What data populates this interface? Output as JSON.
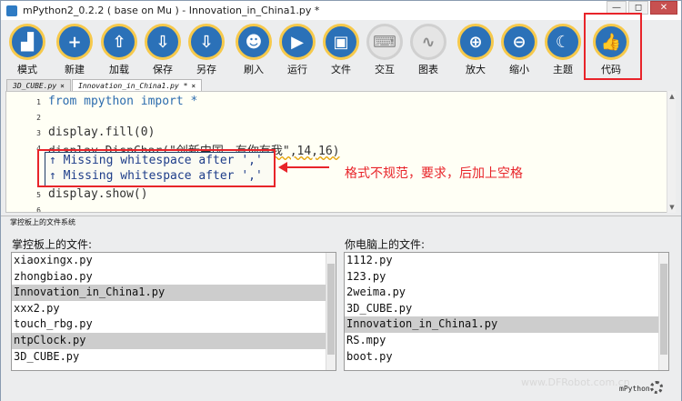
{
  "window": {
    "title": "mPython2_0.2.2 ( base on Mu ) - Innovation_in_China1.py *",
    "buttons": [
      "—",
      "◻",
      "✕"
    ]
  },
  "toolbar": {
    "buttons": [
      {
        "label": "模式",
        "icon": "mode-icon",
        "glyph": "▟"
      },
      {
        "label": "新建",
        "icon": "plus-icon",
        "glyph": "+"
      },
      {
        "label": "加载",
        "icon": "upload-icon",
        "glyph": "⇧"
      },
      {
        "label": "保存",
        "icon": "download-icon",
        "glyph": "⇩"
      },
      {
        "label": "另存",
        "icon": "save-as-icon",
        "glyph": "⇩"
      },
      {
        "label": "刷入",
        "icon": "robot-icon",
        "glyph": "☻"
      },
      {
        "label": "运行",
        "icon": "play-icon",
        "glyph": "▶"
      },
      {
        "label": "文件",
        "icon": "files-icon",
        "glyph": "▣"
      },
      {
        "label": "交互",
        "icon": "keyboard-icon",
        "glyph": "⌨"
      },
      {
        "label": "图表",
        "icon": "pulse-icon",
        "glyph": "∿"
      },
      {
        "label": "放大",
        "icon": "zoom-in-icon",
        "glyph": "⊕"
      },
      {
        "label": "缩小",
        "icon": "zoom-out-icon",
        "glyph": "⊖"
      },
      {
        "label": "主题",
        "icon": "moon-icon",
        "glyph": "☾"
      },
      {
        "label": "代码",
        "icon": "thumbs-up-icon",
        "glyph": "👍"
      }
    ]
  },
  "tabs": [
    {
      "label": "3D_CUBE.py",
      "close": "×"
    },
    {
      "label": "Innovation_in_China1.py *",
      "close": "×"
    }
  ],
  "editor": {
    "lines": [
      {
        "num": "1",
        "code": "from mpython import *"
      },
      {
        "num": "2",
        "code": ""
      },
      {
        "num": "3",
        "code": "display.fill(0)"
      },
      {
        "num": "4",
        "code": "display.DispChar(\"创新中国，有你有我\",14,16)"
      },
      {
        "num": "5",
        "code": "display.show()"
      },
      {
        "num": "6",
        "code": ""
      }
    ],
    "lint_messages": [
      "↑ Missing whitespace after ','",
      "↑ Missing whitespace after ','"
    ]
  },
  "annotation": "格式不规范，要求，后加上空格",
  "file_pane": {
    "title": "掌控板上的文件系统",
    "left_label": "掌控板上的文件:",
    "right_label": "你电脑上的文件:",
    "left_files": [
      "xiaoxingx.py",
      "zhongbiao.py",
      "Innovation_in_China1.py",
      "xxx2.py",
      "touch_rbg.py",
      "ntpClock.py",
      "3D_CUBE.py"
    ],
    "left_selected": [
      2,
      5
    ],
    "right_files": [
      "1112.py",
      "123.py",
      "2weima.py",
      "3D_CUBE.py",
      "Innovation_in_China1.py",
      "RS.mpy",
      "boot.py"
    ],
    "right_selected": [
      4
    ]
  },
  "status": {
    "watermark": "www.DFRobot.com.cn",
    "mode": "mPython"
  },
  "colors": {
    "button_blue": "#2b71b8",
    "button_ring": "#f6c94b",
    "highlight_red": "#e8242a"
  }
}
